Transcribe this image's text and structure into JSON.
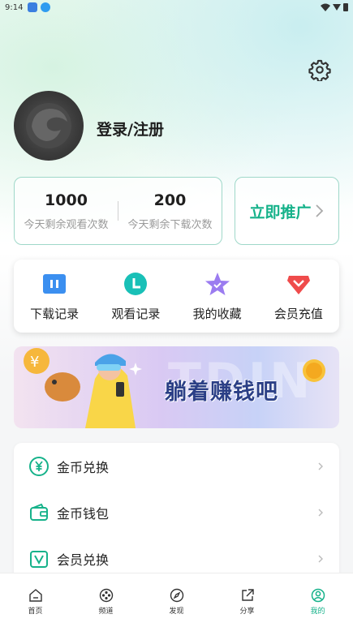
{
  "status_bar": {
    "time": "9:14"
  },
  "profile": {
    "login_label": "登录/注册"
  },
  "stats": [
    {
      "value": "1000",
      "label": "今天剩余观看次数"
    },
    {
      "value": "200",
      "label": "今天剩余下载次数"
    }
  ],
  "promote": {
    "label": "立即推广"
  },
  "quick_actions": [
    {
      "label": "下载记录",
      "icon": "download-record-icon",
      "color": "#3b8ff0"
    },
    {
      "label": "观看记录",
      "icon": "clock-icon",
      "color": "#19c0b7"
    },
    {
      "label": "我的收藏",
      "icon": "star-icon",
      "color": "#9b7cf0"
    },
    {
      "label": "会员充值",
      "icon": "vip-diamond-icon",
      "color": "#ef4b4b"
    }
  ],
  "banner": {
    "text": "躺着赚钱吧",
    "bg_text": "TDIN"
  },
  "menu": [
    {
      "label": "金币兑换",
      "icon": "yuan-coin-icon"
    },
    {
      "label": "金币钱包",
      "icon": "wallet-icon"
    },
    {
      "label": "会员兑换",
      "icon": "vip-exchange-icon"
    }
  ],
  "tabs": [
    {
      "label": "首页",
      "icon": "home-icon"
    },
    {
      "label": "频道",
      "icon": "channel-icon"
    },
    {
      "label": "发现",
      "icon": "compass-icon"
    },
    {
      "label": "分享",
      "icon": "share-icon"
    },
    {
      "label": "我的",
      "icon": "profile-icon",
      "active": true
    }
  ],
  "colors": {
    "accent": "#16b28a",
    "border": "#9fd8c9"
  }
}
